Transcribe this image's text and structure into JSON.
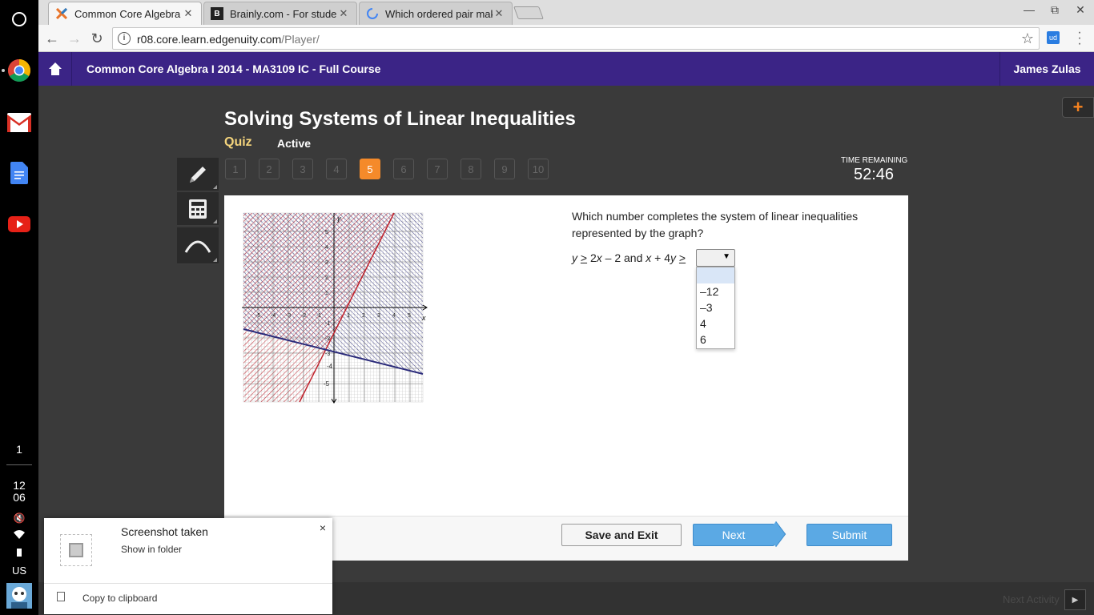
{
  "browser": {
    "tabs": [
      {
        "title": "Common Core Algebra I",
        "active": true
      },
      {
        "title": "Brainly.com - For studen",
        "active": false
      },
      {
        "title": "Which ordered pair mak",
        "active": false
      }
    ],
    "url_host": "r08.core.learn.edgenuity.com",
    "url_path": "/Player/",
    "ext_label": "ud"
  },
  "shelf": {
    "notif_count": "1",
    "clock_hour": "12",
    "clock_min": "06",
    "locale": "US"
  },
  "header": {
    "course_title": "Common Core Algebra I 2014 - MA3109 IC - Full Course",
    "user_name": "James Zulas"
  },
  "lesson": {
    "title": "Solving Systems of Linear Inequalities",
    "type": "Quiz",
    "status": "Active",
    "questions": [
      "1",
      "2",
      "3",
      "4",
      "5",
      "6",
      "7",
      "8",
      "9",
      "10"
    ],
    "current_question": "5",
    "time_label": "TIME REMAINING",
    "time_value": "52:46"
  },
  "question": {
    "text": "Which number completes the system of linear inequalities represented by the graph?",
    "eq_part1_var": "y",
    "eq_part1_op": "≥",
    "eq_part1_expr": "2",
    "eq_part1_x": "x",
    "eq_part1_rest": "– 2 and",
    "eq_part2_x": "x",
    "eq_part2_plus": "+ 4",
    "eq_part2_y": "y",
    "eq_part2_op": "≥",
    "dropdown_options": [
      "",
      "–12",
      "–3",
      "4",
      "6"
    ]
  },
  "graph": {
    "x_axis_label": "x",
    "y_axis_label": "y",
    "tick_labels_x": [
      "-5",
      "-4",
      "-3",
      "-2",
      "-1",
      "1",
      "2",
      "3",
      "4",
      "5"
    ],
    "tick_labels_y": [
      "5",
      "4",
      "3",
      "2",
      "1",
      "-1",
      "-2",
      "-3",
      "-4",
      "-5"
    ],
    "line1_color": "#c0202a",
    "line2_color": "#2a2a7a"
  },
  "buttons": {
    "save_exit": "Save and Exit",
    "next": "Next",
    "submit": "Submit"
  },
  "footer": {
    "next_activity": "Next Activity"
  },
  "notification": {
    "title": "Screenshot taken",
    "link": "Show in folder",
    "action": "Copy to clipboard",
    "close": "×"
  },
  "colors": {
    "header_purple": "#3b2486",
    "accent_orange": "#f58a2a",
    "button_blue": "#5ba9e4",
    "quiz_yellow": "#f4d47c"
  }
}
